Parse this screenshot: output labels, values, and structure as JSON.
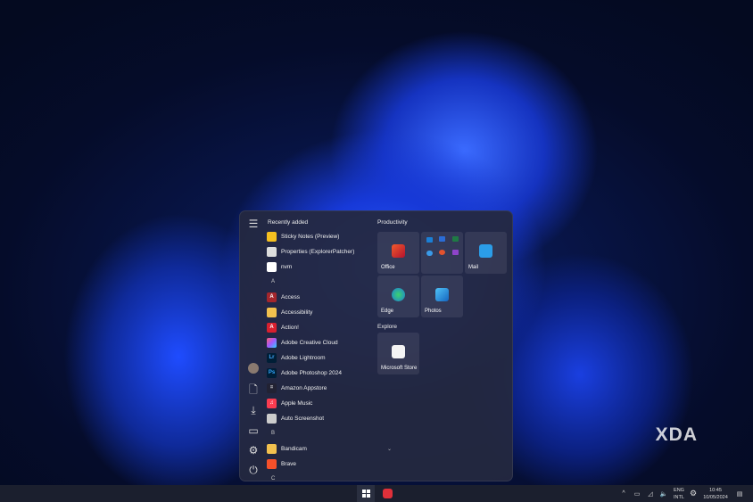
{
  "start_menu": {
    "recently_added_label": "Recently added",
    "apps": [
      {
        "label": "Sticky Notes (Preview)",
        "icon": "sticky-notes-icon"
      },
      {
        "label": "Properties (ExplorerPatcher)",
        "icon": "properties-icon"
      },
      {
        "label": "nvm",
        "icon": "file-icon"
      },
      {
        "letter": "A"
      },
      {
        "label": "Access",
        "icon": "access-icon",
        "glyph": "A"
      },
      {
        "label": "Accessibility",
        "icon": "folder-icon",
        "expandable": true
      },
      {
        "label": "Action!",
        "icon": "action-icon",
        "glyph": "A"
      },
      {
        "label": "Adobe Creative Cloud",
        "icon": "creative-cloud-icon"
      },
      {
        "label": "Adobe Lightroom",
        "icon": "lightroom-icon",
        "glyph": "Lr"
      },
      {
        "label": "Adobe Photoshop 2024",
        "icon": "photoshop-icon",
        "glyph": "Ps"
      },
      {
        "label": "Amazon Appstore",
        "icon": "amazon-appstore-icon",
        "glyph": "="
      },
      {
        "label": "Apple Music",
        "icon": "apple-music-icon",
        "glyph": "♫"
      },
      {
        "label": "Auto Screenshot",
        "icon": "camera-icon"
      },
      {
        "letter": "B"
      },
      {
        "label": "Bandicam",
        "icon": "folder-icon",
        "expandable": true
      },
      {
        "label": "Brave",
        "icon": "brave-icon"
      },
      {
        "letter": "C"
      }
    ],
    "productivity_label": "Productivity",
    "explore_label": "Explore",
    "tiles": {
      "office": "Office",
      "mail": "Mail",
      "edge": "Edge",
      "photos": "Photos",
      "store": "Microsoft Store"
    }
  },
  "taskbar": {
    "lang1": "ENG",
    "lang2": "INTL",
    "time": "10:45",
    "date": "10/05/2024"
  },
  "watermark": "XDA",
  "colors": {
    "accent": "#1739d8",
    "menu_bg": "#242840",
    "taskbar_bg": "#1b1f2e"
  }
}
